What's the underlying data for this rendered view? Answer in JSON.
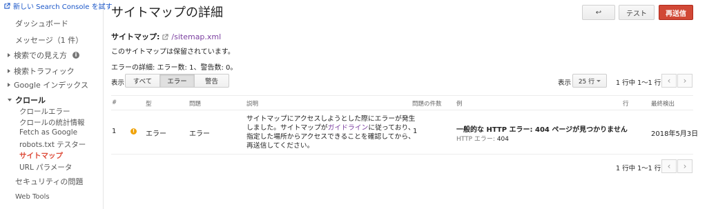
{
  "sidebar": {
    "new_console_link": "新しい Search Console を試す",
    "dashboard": "ダッシュボード",
    "messages": "メッセージ（1 件）",
    "search_appearance": "検索での見え方",
    "search_traffic": "検索トラフィック",
    "google_index": "Google インデックス",
    "crawl": "クロール",
    "crawl_items": [
      "クロールエラー",
      "クロールの統計情報",
      "Fetch as Google",
      "robots.txt テスター",
      "サイトマップ",
      "URL パラメータ"
    ],
    "security": "セキュリティの問題",
    "web_tools": "Web Tools"
  },
  "header": {
    "title": "サイトマップの詳細",
    "back_icon": "↩",
    "test_label": "テスト",
    "resubmit_label": "再送信"
  },
  "sitemap": {
    "label": "サイトマップ:",
    "path": "/sitemap.xml",
    "status_text": "このサイトマップは保留されています。",
    "error_detail": "エラーの詳細: エラー数: 1、警告数: 0。"
  },
  "filter": {
    "show_label": "表示:",
    "tabs": [
      "すべて",
      "エラー",
      "警告"
    ],
    "rows_label": "表示",
    "rows_value": "25 行",
    "pager_text": "1 行中 1～1 行"
  },
  "table": {
    "headers": [
      "#",
      "型",
      "問題",
      "説明",
      "問題の件数",
      "例",
      "行",
      "最終検出"
    ],
    "row": {
      "num": "1",
      "type": "エラー",
      "issue": "エラー",
      "description_pre": "サイトマップにアクセスしようとした際にエラーが発生しました。サイトマップが",
      "description_link": "ガイドライン",
      "description_post": "に従っており、指定した場所からアクセスできることを確認してから、再送信してください。",
      "count": "1",
      "example_main": "一般的な HTTP エラー: 404 ページが見つかりません",
      "example_sub_label": "HTTP エラー:",
      "example_sub_value": "404",
      "line": "-",
      "last_detected": "2018年5月3日"
    }
  },
  "colors": {
    "accent_red": "#d14836",
    "link_blue": "#1a56c8",
    "link_purple": "#7b3fa0",
    "warning": "#f0a30a"
  }
}
